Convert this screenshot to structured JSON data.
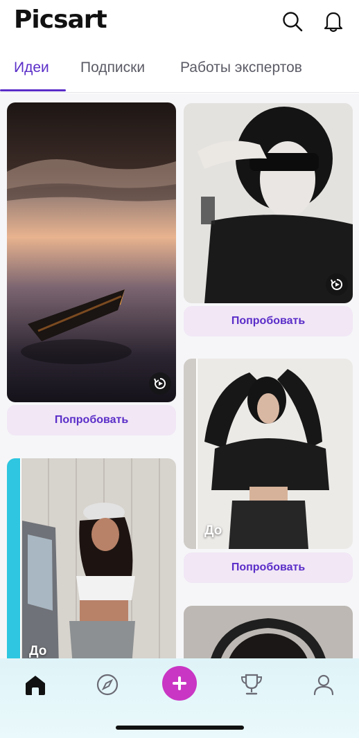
{
  "header": {
    "logo": "Picsart",
    "search_icon": "search-icon",
    "notifications_icon": "bell-icon"
  },
  "tabs": [
    {
      "label": "Идеи",
      "active": true
    },
    {
      "label": "Подписки",
      "active": false
    },
    {
      "label": "Работы экспертов",
      "active": false
    }
  ],
  "feed": {
    "cards": [
      {
        "image": "boat-on-calm-water",
        "try_label": "Попробовать",
        "replay_icon": "replay-icon"
      },
      {
        "image": "girl-sunglasses-blur",
        "try_label": "Попробовать",
        "replay_icon": "replay-icon"
      },
      {
        "image": "girl-leather-jacket",
        "try_label": "Попробовать",
        "before_label": "До"
      },
      {
        "image": "girl-white-cap",
        "before_label": "До"
      },
      {
        "image": "girl-headphones"
      }
    ]
  },
  "bottom_nav": [
    {
      "icon": "home-icon",
      "active": true
    },
    {
      "icon": "compass-icon"
    },
    {
      "icon": "plus-icon"
    },
    {
      "icon": "trophy-icon"
    },
    {
      "icon": "profile-icon"
    }
  ],
  "colors": {
    "accent": "#5a2dc8",
    "try_button_bg": "#f1e7f5",
    "create_button": "#c936c4",
    "nav_bg": "#dff4f8"
  }
}
